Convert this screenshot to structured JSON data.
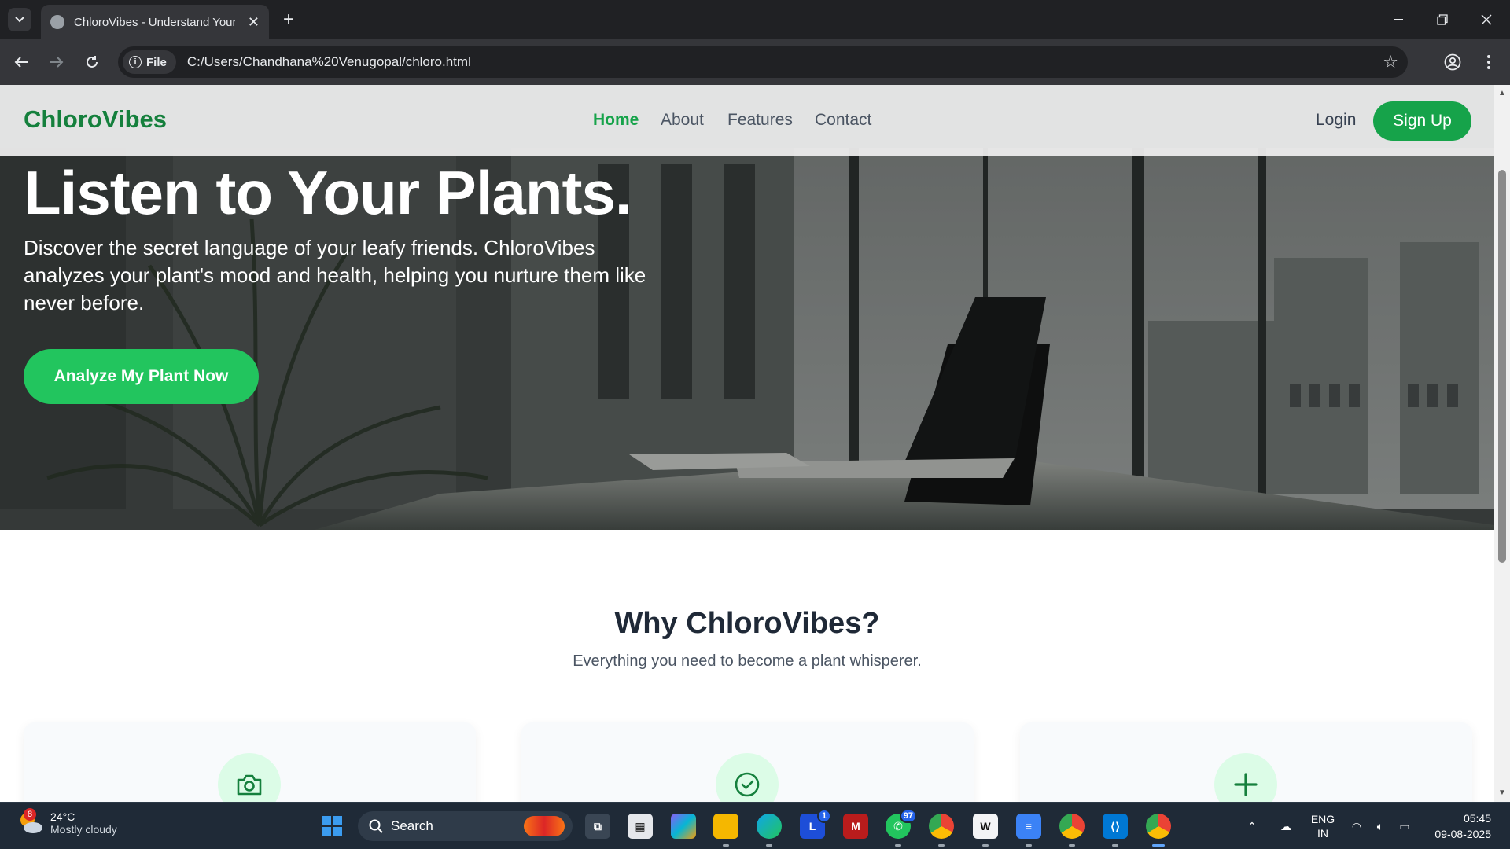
{
  "browser": {
    "tab_title": "ChloroVibes - Understand Your",
    "chip_label": "File",
    "url": "C:/Users/Chandhana%20Venugopal/chloro.html"
  },
  "site": {
    "logo": "ChloroVibes",
    "nav": [
      "Home",
      "About",
      "Features",
      "Contact"
    ],
    "active_nav": "Home",
    "login": "Login",
    "signup": "Sign Up"
  },
  "hero": {
    "title": "Listen to Your Plants.",
    "subtitle": "Discover the secret language of your leafy friends. ChloroVibes analyzes your plant's mood and health, helping you nurture them like never before.",
    "cta": "Analyze My Plant Now"
  },
  "why": {
    "title": "Why ChloroVibes?",
    "subtitle": "Everything you need to become a plant whisperer.",
    "cards": [
      {
        "icon": "camera-icon"
      },
      {
        "icon": "check-circle-icon"
      },
      {
        "icon": "plus-icon"
      }
    ]
  },
  "colors": {
    "brand": "#15803d",
    "accent": "#22c55e",
    "button": "#16a34a",
    "icon_bg": "#dcfce7"
  },
  "taskbar": {
    "weather_badge": "8",
    "temperature": "24°C",
    "weather": "Mostly cloudy",
    "search": "Search",
    "badge_l": "1",
    "badge_whatsapp": "97",
    "lang_top": "ENG",
    "lang_bottom": "IN",
    "time": "05:45",
    "date": "09-08-2025"
  }
}
